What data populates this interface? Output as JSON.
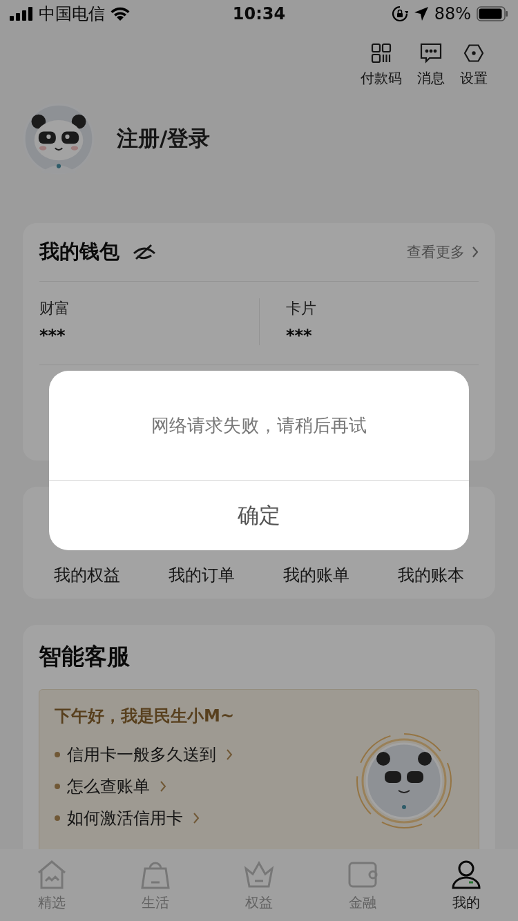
{
  "status_bar": {
    "carrier": "中国电信",
    "time": "10:34",
    "battery": "88%"
  },
  "header_actions": [
    {
      "kind": "qr",
      "label": "付款码"
    },
    {
      "kind": "message",
      "label": "消息"
    },
    {
      "kind": "settings",
      "label": "设置"
    }
  ],
  "profile": {
    "name": "注册/登录"
  },
  "wallet": {
    "title": "我的钱包",
    "more": "查看更多",
    "items": [
      {
        "label": "财富",
        "value": "***"
      },
      {
        "label": "卡片",
        "value": "***"
      }
    ]
  },
  "quick_links": [
    "我的权益",
    "我的订单",
    "我的账单",
    "我的账本"
  ],
  "service": {
    "title": "智能客服",
    "greeting": "下午好，我是民生小M~",
    "questions": [
      "信用卡一般多久送到",
      "怎么查账单",
      "如何激活信用卡"
    ]
  },
  "tab_bar": [
    {
      "kind": "home",
      "label": "精选",
      "selected": false
    },
    {
      "kind": "bag",
      "label": "生活",
      "selected": false
    },
    {
      "kind": "crown",
      "label": "权益",
      "selected": false
    },
    {
      "kind": "wallet",
      "label": "金融",
      "selected": false
    },
    {
      "kind": "person",
      "label": "我的",
      "selected": true
    }
  ],
  "dialog": {
    "message": "网络请求失败，请稍后再试",
    "button": "确定"
  }
}
